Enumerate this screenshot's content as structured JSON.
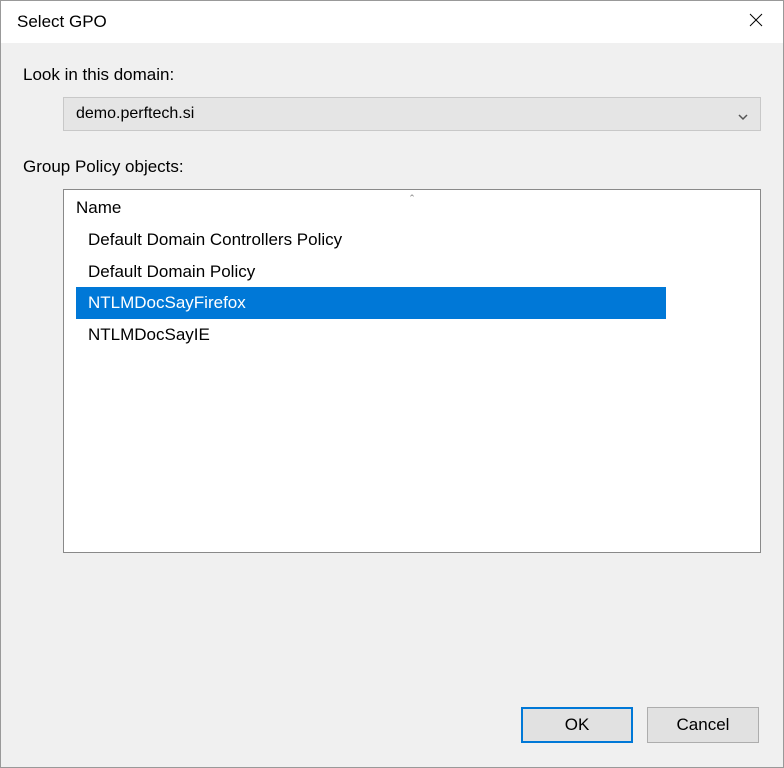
{
  "window": {
    "title": "Select GPO",
    "close_name": "close-icon"
  },
  "domain": {
    "label": "Look in this domain:",
    "value": "demo.perftech.si"
  },
  "gpo": {
    "label": "Group Policy objects:",
    "column_header": "Name",
    "items": [
      {
        "name": "Default Domain Controllers Policy",
        "selected": false
      },
      {
        "name": "Default Domain Policy",
        "selected": false
      },
      {
        "name": "NTLMDocSayFirefox",
        "selected": true
      },
      {
        "name": "NTLMDocSayIE",
        "selected": false
      }
    ]
  },
  "buttons": {
    "ok": "OK",
    "cancel": "Cancel"
  }
}
